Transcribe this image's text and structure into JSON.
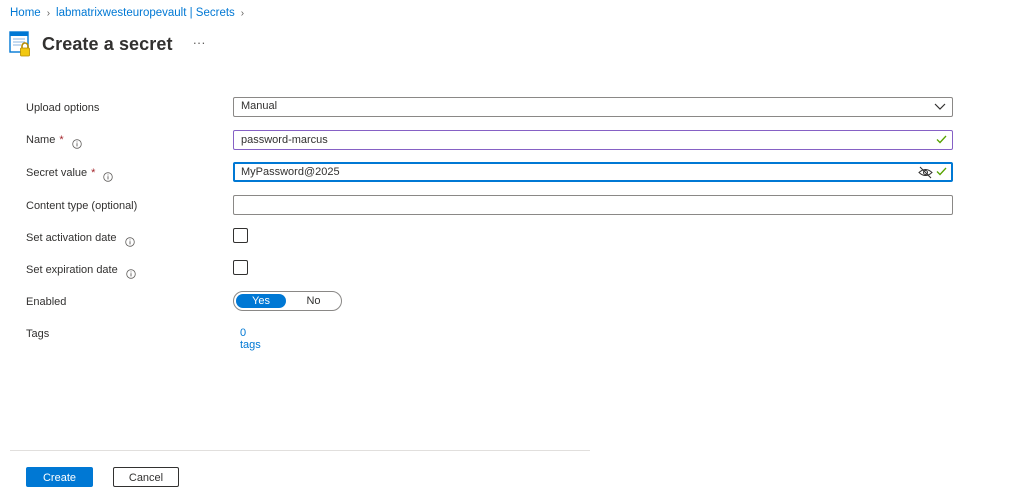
{
  "breadcrumb": [
    {
      "label": "Home"
    },
    {
      "label": "labmatrixwesteuropevault | Secrets"
    }
  ],
  "header": {
    "title": "Create a secret",
    "more": "···"
  },
  "form": {
    "upload_options": {
      "label": "Upload options",
      "value": "Manual"
    },
    "name": {
      "label": "Name",
      "required": "*",
      "value": "password-marcus"
    },
    "secret_value": {
      "label": "Secret value",
      "required": "*",
      "value": "MyPassword@2025"
    },
    "content_type": {
      "label": "Content type (optional)",
      "value": ""
    },
    "activation_date": {
      "label": "Set activation date"
    },
    "expiration_date": {
      "label": "Set expiration date"
    },
    "enabled": {
      "label": "Enabled",
      "yes": "Yes",
      "no": "No",
      "selected": "Yes"
    },
    "tags": {
      "label": "Tags",
      "link": "0 tags"
    }
  },
  "footer": {
    "create_label": "Create",
    "cancel_label": "Cancel"
  },
  "colors": {
    "accent": "#0078d4",
    "success": "#57a300",
    "required": "#a4262c",
    "valid_border": "#8661c5"
  }
}
